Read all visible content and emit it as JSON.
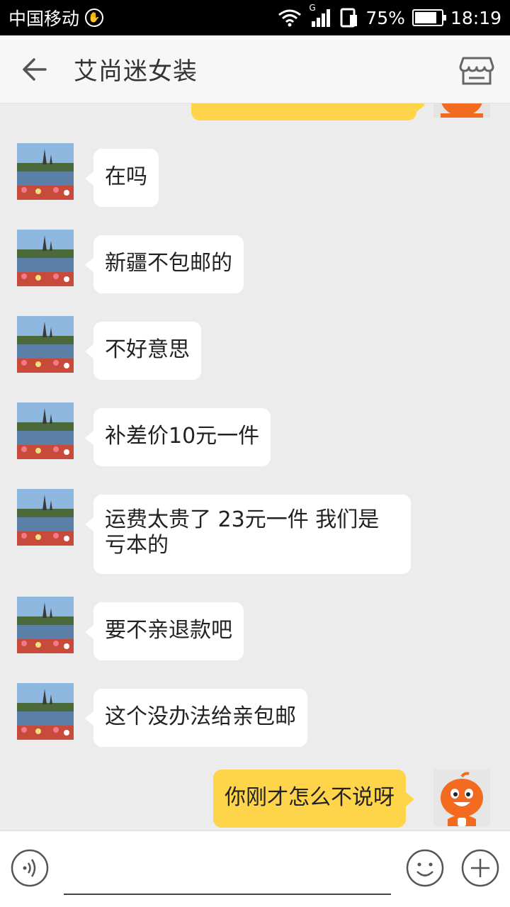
{
  "status_bar": {
    "carrier": "中国移动",
    "network": "G",
    "battery": "75%",
    "time": "18:19"
  },
  "header": {
    "title": "艾尚迷女装"
  },
  "messages": [
    {
      "side": "left",
      "text": "在吗"
    },
    {
      "side": "left",
      "text": "新疆不包邮的"
    },
    {
      "side": "left",
      "text": "不好意思"
    },
    {
      "side": "left",
      "text": "补差价10元一件"
    },
    {
      "side": "left",
      "text": "运费太贵了 23元一件 我们是亏本的"
    },
    {
      "side": "left",
      "text": "要不亲退款吧"
    },
    {
      "side": "left",
      "text": "这个没办法给亲包邮"
    },
    {
      "side": "right",
      "text": "你刚才怎么不说呀"
    }
  ],
  "input": {
    "value": ""
  },
  "colors": {
    "self_bubble": "#fed44a",
    "other_bubble": "#ffffff",
    "background": "#ececec"
  }
}
